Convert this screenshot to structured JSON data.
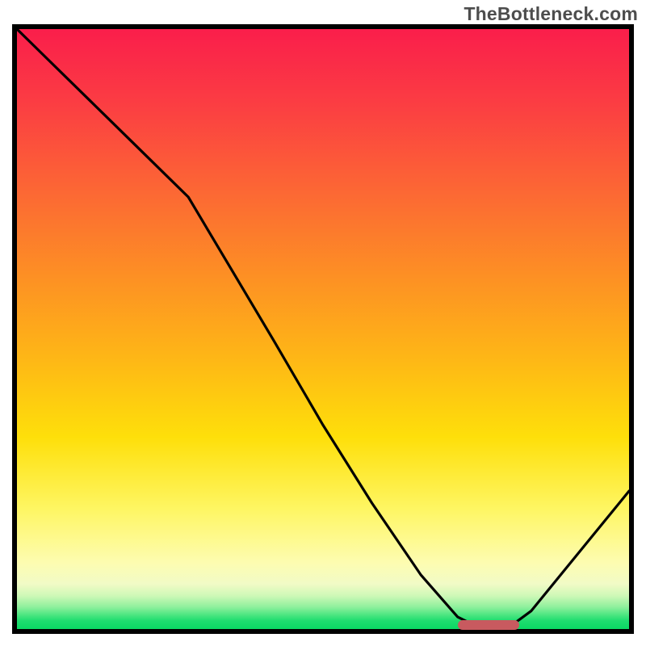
{
  "watermark": "TheBottleneck.com",
  "colors": {
    "border": "#000000",
    "curve": "#000000",
    "marker": "#c85a5f",
    "gradient_top": "#fa1e4b",
    "gradient_mid": "#fedf0a",
    "gradient_bottom": "#0ad863"
  },
  "chart_data": {
    "type": "line",
    "title": "",
    "xlabel": "",
    "ylabel": "",
    "xlim": [
      0,
      100
    ],
    "ylim": [
      0,
      100
    ],
    "series": [
      {
        "name": "curve",
        "x": [
          0,
          6,
          12,
          18,
          24,
          28,
          35,
          42,
          50,
          58,
          66,
          72,
          76,
          80,
          84,
          88,
          92,
          96,
          100
        ],
        "y": [
          100,
          94,
          88,
          82,
          76,
          72,
          60,
          48,
          34,
          21,
          9,
          2,
          0,
          0,
          3,
          8,
          13,
          18,
          23
        ]
      }
    ],
    "annotations": [
      {
        "name": "optimal-range-marker",
        "x_start": 72,
        "x_end": 82,
        "y": 0
      }
    ]
  }
}
